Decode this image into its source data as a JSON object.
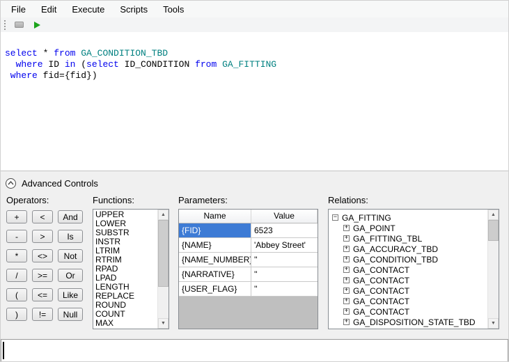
{
  "menu": {
    "items": [
      "File",
      "Edit",
      "Execute",
      "Scripts",
      "Tools"
    ]
  },
  "icons": {
    "up": "▲",
    "down": "▼",
    "plus": "+",
    "minus": "−"
  },
  "editor": {
    "lines": [
      {
        "segs": [
          {
            "t": "select"
          },
          {
            "t": " * "
          },
          {
            "t": "from "
          },
          {
            "t": "GA_CONDITION_TBD"
          }
        ]
      },
      {
        "segs": [
          {
            "t": "  where "
          },
          {
            "t": "ID "
          },
          {
            "t": "in "
          },
          {
            "t": "("
          },
          {
            "t": "select "
          },
          {
            "t": "ID_CONDITION "
          },
          {
            "t": "from "
          },
          {
            "t": "GA_FITTING"
          }
        ]
      },
      {
        "segs": [
          {
            "t": " where "
          },
          {
            "t": "fid={fid})"
          }
        ]
      }
    ]
  },
  "advanced": {
    "label": "Advanced Controls"
  },
  "operators": {
    "label": "Operators:",
    "buttons": [
      "+",
      "<",
      "And",
      "-",
      ">",
      "Is",
      "*",
      "<>",
      "Not",
      "/",
      ">=",
      "Or",
      "(",
      "<=",
      "Like",
      ")",
      "!=",
      "Null"
    ]
  },
  "functions": {
    "label": "Functions:",
    "items": [
      "UPPER",
      "LOWER",
      "SUBSTR",
      "INSTR",
      "LTRIM",
      "RTRIM",
      "RPAD",
      "LPAD",
      "LENGTH",
      "REPLACE",
      "ROUND",
      "COUNT",
      "MAX"
    ]
  },
  "parameters": {
    "label": "Parameters:",
    "headers": [
      "Name",
      "Value"
    ],
    "rows": [
      {
        "name": "{FID}",
        "value": "6523"
      },
      {
        "name": "{NAME}",
        "value": "'Abbey Street'"
      },
      {
        "name": "{NAME_NUMBER}",
        "value": "''"
      },
      {
        "name": "{NARRATIVE}",
        "value": "''"
      },
      {
        "name": "{USER_FLAG}",
        "value": "''"
      }
    ]
  },
  "relations": {
    "label": "Relations:",
    "root": "GA_FITTING",
    "children": [
      "GA_POINT",
      "GA_FITTING_TBL",
      "GA_ACCURACY_TBD",
      "GA_CONDITION_TBD",
      "GA_CONTACT",
      "GA_CONTACT",
      "GA_CONTACT",
      "GA_CONTACT",
      "GA_CONTACT",
      "GA_DISPOSITION_STATE_TBD"
    ]
  }
}
